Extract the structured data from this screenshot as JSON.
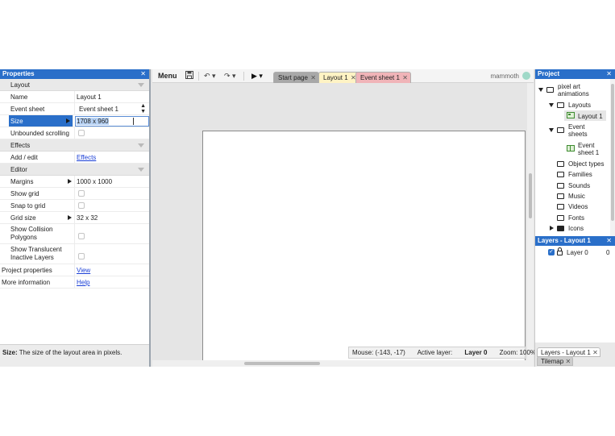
{
  "properties": {
    "title": "Properties",
    "close": "✕",
    "sections": {
      "layout": "Layout",
      "effects": "Effects",
      "editor": "Editor"
    },
    "rows": {
      "name_key": "Name",
      "name_val": "Layout 1",
      "event_key": "Event sheet",
      "event_val": "Event sheet 1",
      "size_key": "Size",
      "size_val": "1708 x 960",
      "unbounded_key": "Unbounded scrolling",
      "addedit_key": "Add / edit",
      "addedit_val": "Effects",
      "margins_key": "Margins",
      "margins_val": "1000 x 1000",
      "showgrid_key": "Show grid",
      "snap_key": "Snap to grid",
      "gridsize_key": "Grid size",
      "gridsize_val": "32 x 32",
      "collision_key": "Show Collision Polygons",
      "translucent_key": "Show Translucent Inactive Layers",
      "projprops_key": "Project properties",
      "projprops_val": "View",
      "moreinfo_key": "More information",
      "moreinfo_val": "Help"
    },
    "help_label": "Size:",
    "help_text": " The size of the layout area in pixels."
  },
  "toolbar": {
    "menu": "Menu",
    "save_icon": "save-icon",
    "undo_icon": "undo-icon",
    "redo_icon": "redo-icon",
    "play_icon": "play-icon",
    "tabs": [
      "Start page",
      "Layout 1",
      "Event sheet 1"
    ],
    "tab_close": "✕",
    "brand": "mammoth"
  },
  "statusbar": {
    "mouse": "Mouse: (-143, -17)",
    "active_layer_label": "Active layer: ",
    "active_layer_val": "Layer 0",
    "zoom": "Zoom: 100%"
  },
  "project": {
    "title": "Project",
    "close": "✕",
    "root": "pixel art animations",
    "layouts": "Layouts",
    "layout1": "Layout 1",
    "event_sheets": "Event sheets",
    "event_sheet1": "Event sheet 1",
    "folders": [
      "Object types",
      "Families",
      "Sounds",
      "Music",
      "Videos",
      "Fonts",
      "Icons"
    ]
  },
  "layers": {
    "title": "Layers - Layout 1",
    "close": "✕",
    "layer_name": "Layer 0",
    "layer_index": "0",
    "bottom_tab1": "Layers - Layout 1",
    "bottom_tab2": "Tilemap",
    "tab_close": "✕"
  },
  "colors": {
    "accent": "#2a6fc9",
    "tab_layout": "#fff3c4",
    "tab_event": "#f0b4b8",
    "tab_start": "#a8a8a8"
  }
}
